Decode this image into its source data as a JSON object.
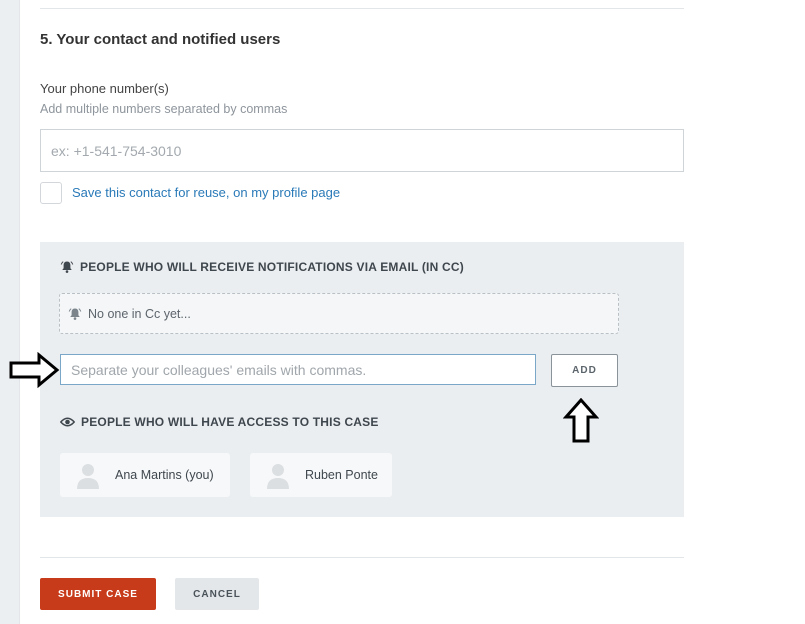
{
  "section": {
    "title": "5. Your contact and notified users"
  },
  "phone": {
    "label": "Your phone number(s)",
    "help": "Add multiple numbers separated by commas",
    "placeholder": "ex: +1-541-754-3010",
    "value": ""
  },
  "save_contact": {
    "label": "Save this contact for reuse, on my profile page",
    "checked": false
  },
  "cc": {
    "heading": "PEOPLE WHO WILL RECEIVE NOTIFICATIONS VIA EMAIL (IN CC)",
    "heading_icon": "bell-icon",
    "empty_text": "No one in Cc yet...",
    "email_placeholder": "Separate your colleagues' emails with commas.",
    "email_value": "",
    "add_label": "ADD"
  },
  "access": {
    "heading": "PEOPLE WHO WILL HAVE ACCESS TO THIS CASE",
    "heading_icon": "eye-icon",
    "users": [
      {
        "name": "Ana Martins (you)",
        "avatar": "avatar-placeholder"
      },
      {
        "name": "Ruben Ponte",
        "avatar": "avatar-placeholder"
      }
    ]
  },
  "actions": {
    "submit_label": "SUBMIT CASE",
    "cancel_label": "CANCEL"
  },
  "colors": {
    "accent_link": "#2a7ab8",
    "submit_bg": "#c73a1a",
    "panel_bg": "#ebeef1"
  }
}
